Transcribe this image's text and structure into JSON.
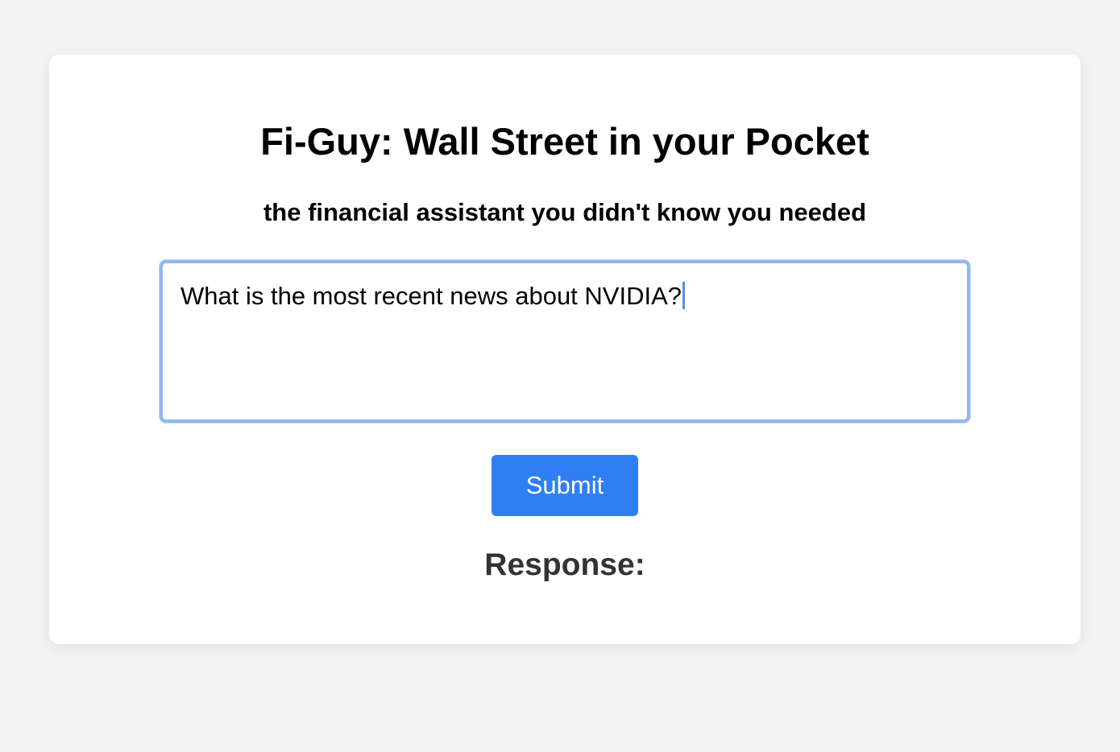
{
  "header": {
    "title": "Fi-Guy: Wall Street in your Pocket",
    "subtitle": "the financial assistant you didn't know you needed"
  },
  "query": {
    "value": "What is the most recent news about NVIDIA?"
  },
  "actions": {
    "submit_label": "Submit"
  },
  "response": {
    "heading": "Response:"
  },
  "colors": {
    "page_background": "#f3f3f3",
    "card_background": "#ffffff",
    "focus_ring": "#93b6ef",
    "submit_button": "#2f7ff3",
    "response_heading": "#333333"
  }
}
